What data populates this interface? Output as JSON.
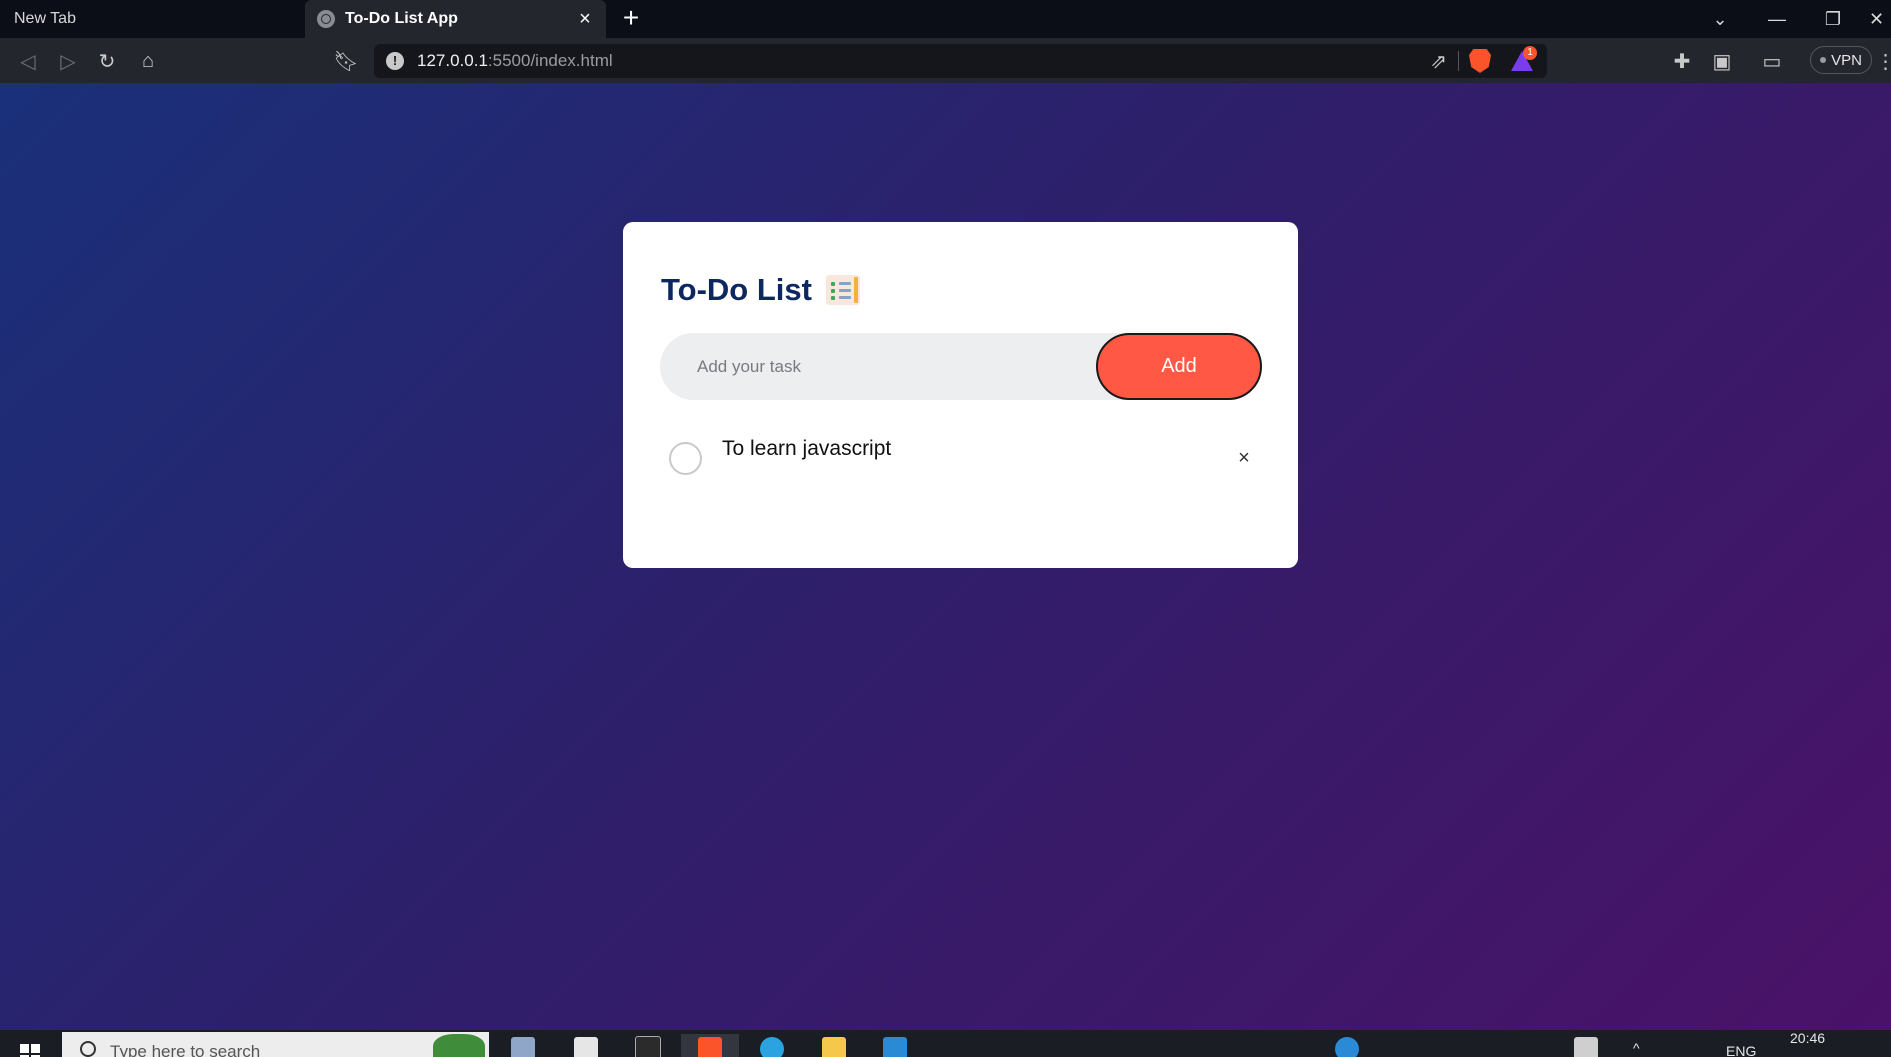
{
  "browser": {
    "tabs": [
      {
        "label": "New Tab",
        "active": false
      },
      {
        "label": "To-Do List App",
        "active": true
      }
    ],
    "address": {
      "host": "127.0.0.1",
      "rest": ":5500/index.html"
    },
    "vpn_label": "VPN",
    "rewards_badge": "1",
    "icons": {
      "back": "back-arrow-icon",
      "forward": "forward-arrow-icon",
      "reload": "reload-icon",
      "home": "home-icon",
      "bookmark": "bookmark-icon",
      "site_info": "info-icon",
      "share": "share-icon",
      "brave": "brave-shields-icon",
      "rewards": "brave-rewards-icon",
      "extensions": "puzzle-icon",
      "sidebar": "sidebar-icon",
      "wallet": "wallet-icon",
      "menu": "menu-icon"
    }
  },
  "page": {
    "background": {
      "from": "#1a307a",
      "to": "#4a1268"
    },
    "todo": {
      "title": "To-Do List",
      "title_icon": "clipboard-list-icon",
      "input_placeholder": "Add your task",
      "add_label": "Add",
      "accent": "#ff5945",
      "title_color": "#0d2760",
      "tasks": [
        {
          "text": "To learn javascript",
          "done": false
        }
      ],
      "delete_glyph": "×"
    }
  },
  "taskbar": {
    "search_placeholder": "Type here to search",
    "language": "ENG",
    "time": "20:46"
  }
}
